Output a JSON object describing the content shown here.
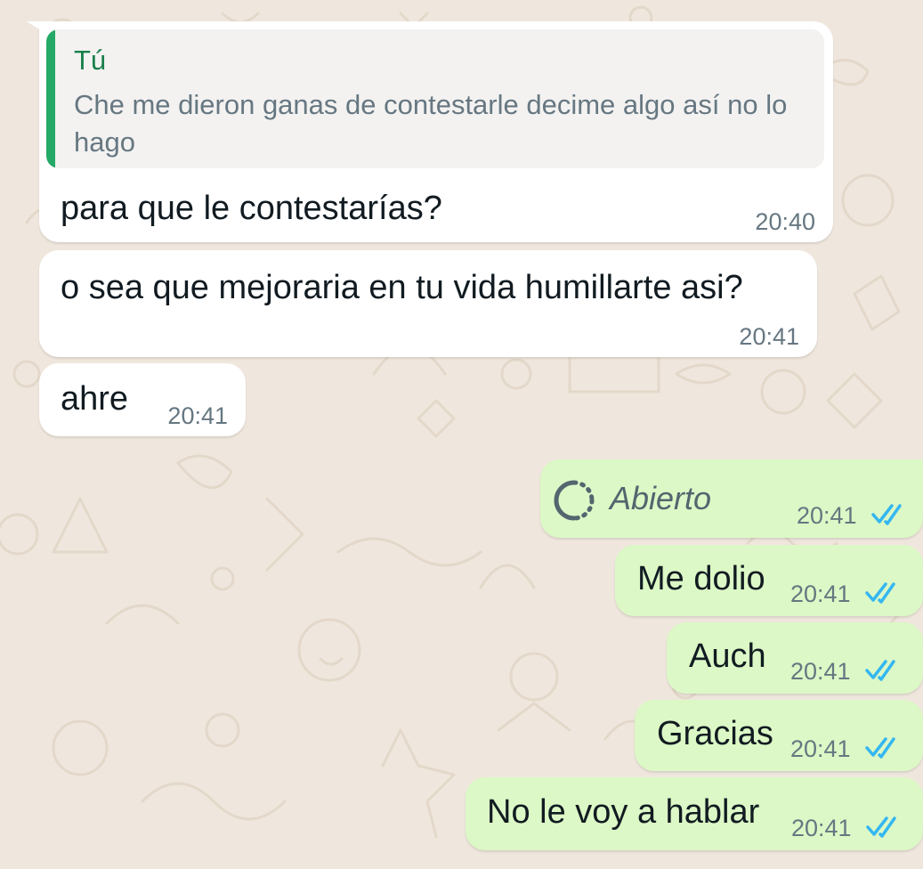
{
  "chat": {
    "colors": {
      "background": "#efe7dd",
      "incoming_bubble": "#ffffff",
      "outgoing_bubble": "#dcf8c6",
      "quote_accent": "#25a966",
      "read_ticks": "#34b7f1"
    },
    "reply_quote": {
      "author": "Tú",
      "text": "Che me dieron ganas de contestarle decime algo así no lo hago"
    },
    "messages": [
      {
        "direction": "incoming",
        "text": "para que le contestarías?",
        "time": "20:40"
      },
      {
        "direction": "incoming",
        "text": "o sea que mejoraria en tu vida humillarte asi?",
        "time": "20:41"
      },
      {
        "direction": "incoming",
        "text": "ahre",
        "time": "20:41"
      },
      {
        "direction": "outgoing",
        "type": "status",
        "icon": "status-ring-icon",
        "text": "Abierto",
        "time": "20:41",
        "read": true
      },
      {
        "direction": "outgoing",
        "text": "Me dolio",
        "time": "20:41",
        "read": true
      },
      {
        "direction": "outgoing",
        "text": "Auch",
        "time": "20:41",
        "read": true
      },
      {
        "direction": "outgoing",
        "text": "Gracias",
        "time": "20:41",
        "read": true
      },
      {
        "direction": "outgoing",
        "text": "No le voy a hablar",
        "time": "20:41",
        "read": true
      }
    ]
  }
}
